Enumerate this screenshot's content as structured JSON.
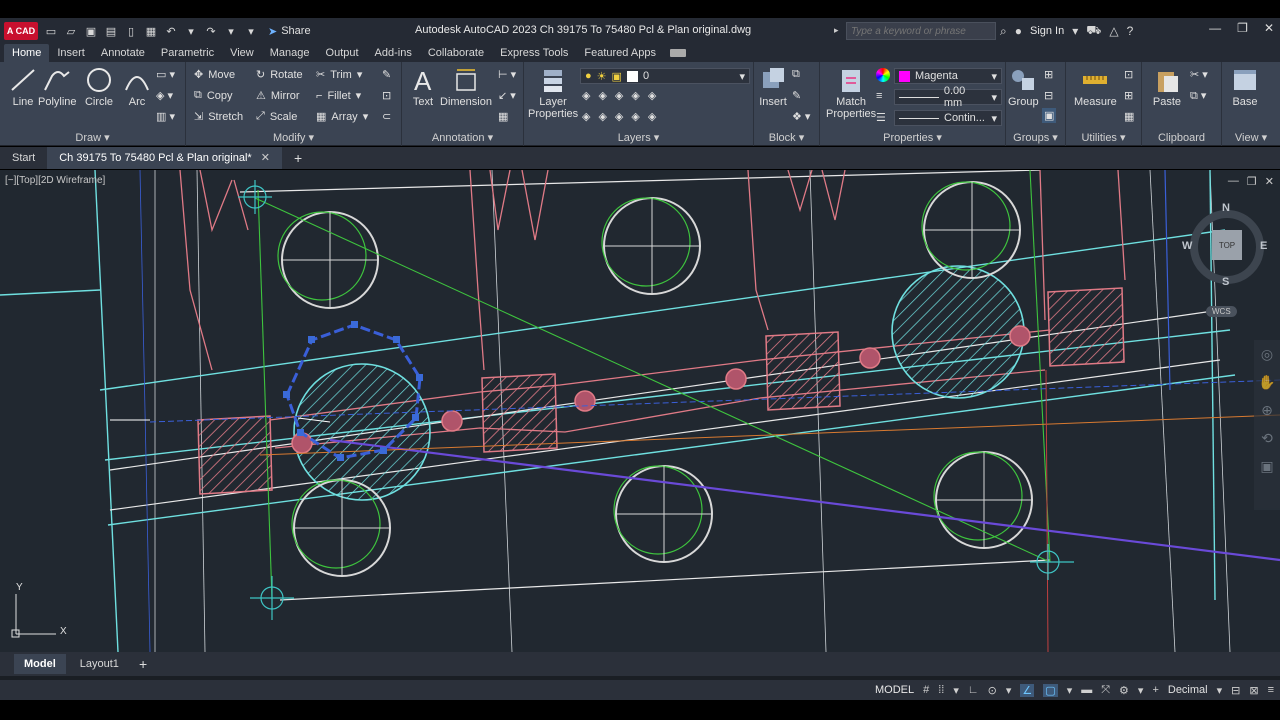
{
  "app": {
    "logo": "A CAD",
    "title": "Autodesk AutoCAD 2023   Ch 39175 To 75480 Pcl & Plan original.dwg",
    "share_label": "Share",
    "search_placeholder": "Type a keyword or phrase",
    "sign_in": "Sign In"
  },
  "ribbon_tabs": [
    "Home",
    "Insert",
    "Annotate",
    "Parametric",
    "View",
    "Manage",
    "Output",
    "Add-ins",
    "Collaborate",
    "Express Tools",
    "Featured Apps"
  ],
  "ribbon": {
    "draw": {
      "title": "Draw",
      "line": "Line",
      "polyline": "Polyline",
      "circle": "Circle",
      "arc": "Arc"
    },
    "modify": {
      "title": "Modify",
      "move": "Move",
      "rotate": "Rotate",
      "trim": "Trim",
      "copy": "Copy",
      "mirror": "Mirror",
      "fillet": "Fillet",
      "stretch": "Stretch",
      "scale": "Scale",
      "array": "Array"
    },
    "annotation": {
      "title": "Annotation",
      "text": "Text",
      "dimension": "Dimension"
    },
    "layers": {
      "title": "Layers",
      "layer_properties_1": "Layer",
      "layer_properties_2": "Properties",
      "current_layer": "0"
    },
    "block": {
      "title": "Block",
      "insert": "Insert"
    },
    "properties": {
      "title": "Properties",
      "match_1": "Match",
      "match_2": "Properties",
      "color": "Magenta",
      "color_hex": "#ff00ff",
      "lineweight": "0.00 mm",
      "linetype": "Contin..."
    },
    "groups": {
      "title": "Groups",
      "group": "Group"
    },
    "utilities": {
      "title": "Utilities",
      "measure": "Measure"
    },
    "clipboard": {
      "title": "Clipboard",
      "paste": "Paste"
    },
    "view": {
      "title": "View",
      "base": "Base"
    }
  },
  "file_tabs": {
    "start": "Start",
    "active": "Ch 39175 To 75480 Pcl & Plan original*"
  },
  "viewport": {
    "label": "[−][Top][2D Wireframe]",
    "viewcube": {
      "n": "N",
      "s": "S",
      "e": "E",
      "w": "W",
      "top": "TOP",
      "wcs": "WCS"
    },
    "ucs": {
      "x": "X",
      "y": "Y"
    }
  },
  "layout_tabs": [
    "Model",
    "Layout1"
  ],
  "status": {
    "model": "MODEL",
    "units": "Decimal"
  },
  "colors": {
    "background": "#212830",
    "ribbon": "#3b4453",
    "hatch": "#e07a86",
    "cyan": "#6fe0e0",
    "green": "#3ec43e",
    "selection": "#3a5fd8"
  }
}
